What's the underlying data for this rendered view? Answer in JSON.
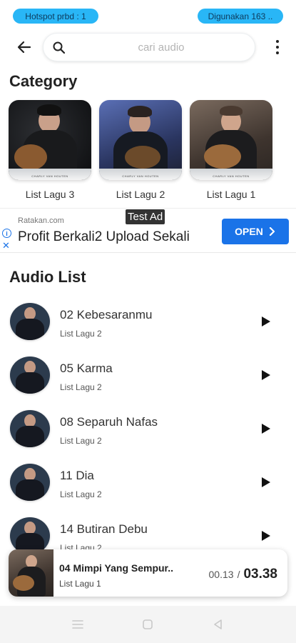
{
  "status": {
    "hotspot": "Hotspot prbd : 1",
    "used": "Digunakan 163 .."
  },
  "search": {
    "placeholder": "cari audio"
  },
  "sections": {
    "category": "Category",
    "audio_list": "Audio List"
  },
  "categories": [
    {
      "label": "List Lagu 3",
      "caption": "CHARLY VAN HOUTEN"
    },
    {
      "label": "List Lagu 2",
      "caption": "CHARLY VAN HOUTEN"
    },
    {
      "label": "List Lagu 1",
      "caption": "CHARLY VAN HOUTEN"
    }
  ],
  "ad": {
    "badge": "Test Ad",
    "source": "Ratakan.com",
    "headline": "Profit Berkali2 Upload Sekali",
    "cta": "OPEN"
  },
  "audio_items": [
    {
      "title": "02 Kebesaranmu",
      "subtitle": "List Lagu 2"
    },
    {
      "title": "05 Karma",
      "subtitle": "List Lagu 2"
    },
    {
      "title": "08 Separuh Nafas",
      "subtitle": "List Lagu 2"
    },
    {
      "title": "11 Dia",
      "subtitle": "List Lagu 2"
    },
    {
      "title": "14 Butiran Debu",
      "subtitle": "List Lagu 2"
    }
  ],
  "now_playing": {
    "title": "04 Mimpi Yang Sempur..",
    "subtitle": "List Lagu 1",
    "current_time": "00.13",
    "separator": "/",
    "total_time": "03.38"
  },
  "colors": {
    "accent": "#29b6f6",
    "ad_button": "#1a73e8"
  }
}
